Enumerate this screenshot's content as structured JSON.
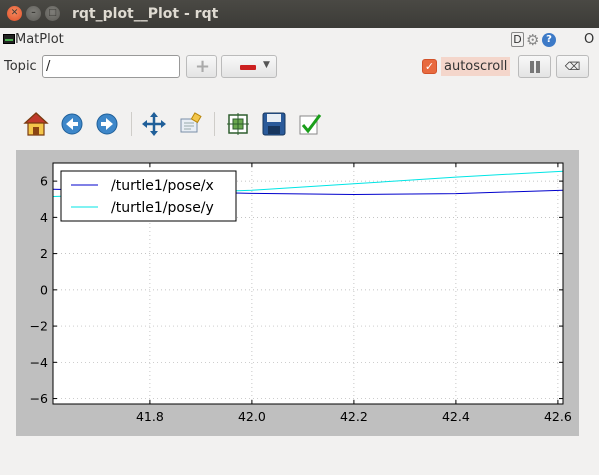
{
  "window": {
    "title": "rqt_plot__Plot - rqt"
  },
  "plugin": {
    "title": "MatPlot",
    "d_label": "D",
    "help_label": "?",
    "close_label": "O"
  },
  "topic": {
    "label": "Topic",
    "value": "/"
  },
  "autoscroll": {
    "label": "autoscroll",
    "checked": true
  },
  "toolbar": {
    "icons": [
      "home-icon",
      "back-icon",
      "forward-icon",
      "pan-icon",
      "zoom-icon",
      "subplots-icon",
      "save-icon",
      "edit-check-icon"
    ]
  },
  "colors": {
    "series_x": "#0000cc",
    "series_y": "#00e5e5",
    "plot_background": "#bfbfbf",
    "accent": "#e86a3f"
  },
  "chart_data": {
    "type": "line",
    "xlim": [
      41.61,
      42.61
    ],
    "ylim": [
      -6.3,
      7.0
    ],
    "xticks": [
      41.8,
      42.0,
      42.2,
      42.4,
      42.6
    ],
    "xtick_labels": [
      "41.8",
      "42.0",
      "42.2",
      "42.4",
      "42.6"
    ],
    "yticks": [
      -6,
      -4,
      -2,
      0,
      2,
      4,
      6
    ],
    "ytick_labels": [
      "−6",
      "−4",
      "−2",
      "0",
      "2",
      "4",
      "6"
    ],
    "grid": true,
    "legend_position": "top-left",
    "series": [
      {
        "name": "/turtle1/pose/x",
        "color": "#0000cc",
        "x": [
          41.61,
          41.8,
          42.0,
          42.2,
          42.4,
          42.61
        ],
        "y": [
          5.55,
          5.45,
          5.32,
          5.26,
          5.31,
          5.5
        ]
      },
      {
        "name": "/turtle1/pose/y",
        "color": "#00e5e5",
        "x": [
          41.61,
          41.8,
          42.0,
          42.2,
          42.4,
          42.61
        ],
        "y": [
          5.15,
          5.3,
          5.5,
          5.85,
          6.22,
          6.55
        ]
      }
    ]
  }
}
